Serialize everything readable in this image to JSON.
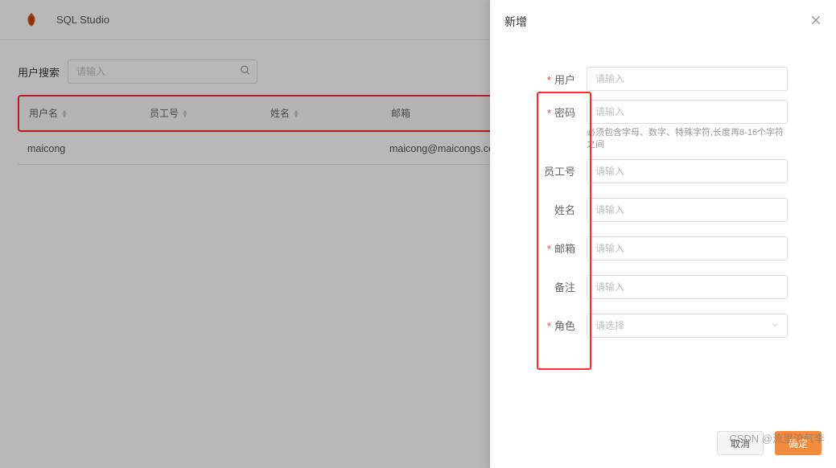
{
  "header": {
    "app_title": "SQL Studio"
  },
  "search": {
    "label": "用户搜索",
    "placeholder": "请输入"
  },
  "table": {
    "columns": {
      "username": "用户名",
      "employee_no": "员工号",
      "name": "姓名",
      "email": "邮箱"
    },
    "rows": [
      {
        "username": "maicong",
        "employee_no": "",
        "name": "",
        "email": "maicong@maicongs.com"
      }
    ]
  },
  "drawer": {
    "title": "新增",
    "fields": {
      "user": {
        "label": "用户",
        "required": true,
        "placeholder": "请输入"
      },
      "password": {
        "label": "密码",
        "required": true,
        "placeholder": "请输入",
        "hint": "必须包含字母、数字、特殊字符,长度再8-16个字符之间"
      },
      "employee": {
        "label": "员工号",
        "required": false,
        "placeholder": "请输入"
      },
      "name": {
        "label": "姓名",
        "required": false,
        "placeholder": "请输入"
      },
      "email": {
        "label": "邮箱",
        "required": true,
        "placeholder": "请输入"
      },
      "remark": {
        "label": "备注",
        "required": false,
        "placeholder": "请输入"
      },
      "role": {
        "label": "角色",
        "required": true,
        "placeholder": "请选择"
      }
    },
    "buttons": {
      "cancel": "取消",
      "confirm": "确定"
    }
  },
  "watermark": "CSDN @流里流气李"
}
